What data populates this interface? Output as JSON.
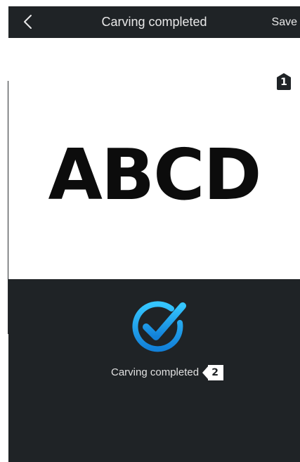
{
  "nav": {
    "title": "Carving completed",
    "save_label": "Save",
    "back_icon": "chevron-left-icon"
  },
  "callouts": {
    "first": "1",
    "second": "2"
  },
  "preview": {
    "text": "ABCD"
  },
  "status": {
    "message": "Carving completed",
    "icon": "check-circle-icon",
    "accent_color": "#1ea7f0"
  },
  "colors": {
    "app_background": "#1f2326",
    "preview_background": "#ffffff",
    "nav_text": "#e8e8e8"
  }
}
